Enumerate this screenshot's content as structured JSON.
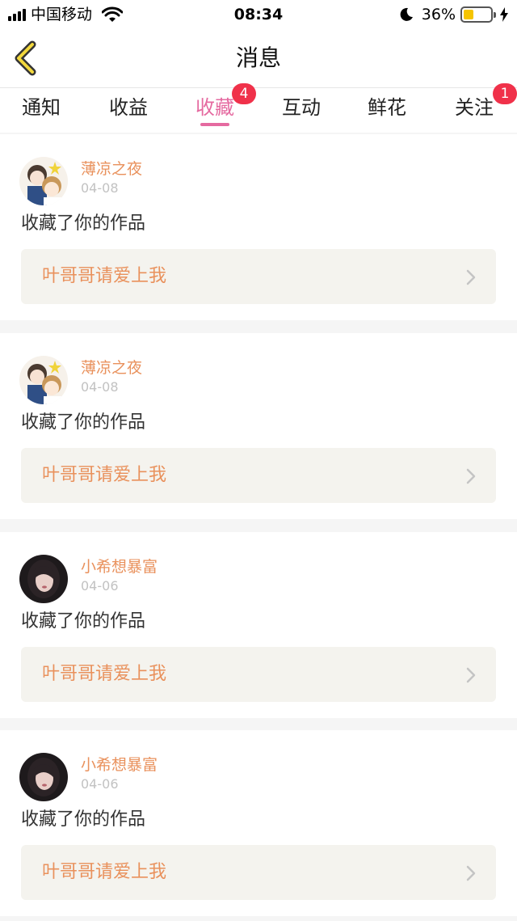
{
  "status_bar": {
    "carrier": "中国移动",
    "time": "08:34",
    "battery_percent": "36%",
    "battery_level": 0.36,
    "icons": [
      "signal-icon",
      "wifi-icon",
      "moon-icon",
      "battery-icon",
      "charging-bolt-icon"
    ]
  },
  "nav": {
    "title": "消息",
    "back_icon": "chevron-left-icon"
  },
  "tabs": [
    {
      "label": "通知",
      "badge": ""
    },
    {
      "label": "收益",
      "badge": ""
    },
    {
      "label": "收藏",
      "badge": "4",
      "active": true
    },
    {
      "label": "互动",
      "badge": ""
    },
    {
      "label": "鲜花",
      "badge": ""
    },
    {
      "label": "关注",
      "badge": "1"
    }
  ],
  "colors": {
    "accent_pink": "#e56aa0",
    "username_orange": "#e9915c",
    "badge_red": "#f0314a",
    "battery_yellow": "#f5c400"
  },
  "messages": [
    {
      "username": "薄凉之夜",
      "date": "04-08",
      "action": "收藏了你的作品",
      "work_title": "叶哥哥请爱上我",
      "avatar": "avatar-anime-couple"
    },
    {
      "username": "薄凉之夜",
      "date": "04-08",
      "action": "收藏了你的作品",
      "work_title": "叶哥哥请爱上我",
      "avatar": "avatar-anime-couple"
    },
    {
      "username": "小希想暴富",
      "date": "04-06",
      "action": "收藏了你的作品",
      "work_title": "叶哥哥请爱上我",
      "avatar": "avatar-girl-photo"
    },
    {
      "username": "小希想暴富",
      "date": "04-06",
      "action": "收藏了你的作品",
      "work_title": "叶哥哥请爱上我",
      "avatar": "avatar-girl-photo"
    }
  ]
}
